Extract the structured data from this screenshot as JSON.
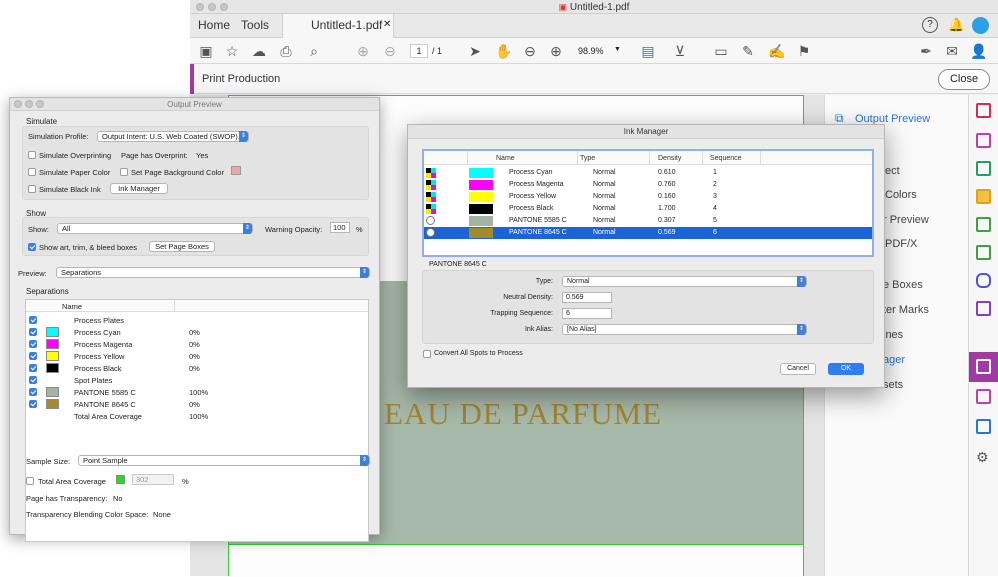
{
  "app": {
    "window_title": "Untitled-1.pdf",
    "tabs": {
      "home": "Home",
      "tools": "Tools",
      "document": "Untitled-1.pdf"
    },
    "toolbar": {
      "page_current": "1",
      "page_total": "/ 1",
      "zoom": "98.9%"
    },
    "print_production": {
      "title": "Print Production",
      "close_label": "Close"
    },
    "document_text": "EAU DE PARFUME",
    "right_panel": [
      {
        "label": "Output Preview"
      },
      {
        "label": "ect"
      },
      {
        "label": "Colors"
      },
      {
        "label": "r Preview"
      },
      {
        "label": "PDF/X"
      },
      {
        "label": "e Boxes"
      },
      {
        "label": "ter Marks"
      },
      {
        "label": "ines"
      },
      {
        "label": "ager"
      },
      {
        "label": "sets"
      }
    ]
  },
  "output_preview": {
    "title": "Output Preview",
    "simulate": {
      "header": "Simulate",
      "profile_label": "Simulation Profile:",
      "profile_value": "Output Intent: U.S. Web Coated (SWOP)...",
      "overprinting_label": "Simulate Overprinting",
      "page_overprint_label": "Page has Overprint:",
      "page_overprint_value": "Yes",
      "paper_color_label": "Simulate Paper Color",
      "bg_color_label": "Set Page Background Color",
      "black_ink_label": "Simulate Black Ink",
      "ink_manager_button": "Ink Manager"
    },
    "show": {
      "header": "Show",
      "show_label": "Show:",
      "show_value": "All",
      "warning_label": "Warning Opacity:",
      "warning_value": "100",
      "warning_unit": "%",
      "boxes_label": "Show art, trim, & bleed boxes",
      "boxes_button": "Set Page Boxes"
    },
    "preview_label": "Preview:",
    "preview_value": "Separations",
    "separations": {
      "header": "Separations",
      "column_name": "Name",
      "rows": [
        {
          "name": "Process Plates",
          "value": "",
          "color": ""
        },
        {
          "name": "Process Cyan",
          "value": "0%",
          "color": "#00ffff"
        },
        {
          "name": "Process Magenta",
          "value": "0%",
          "color": "#ff00ff"
        },
        {
          "name": "Process Yellow",
          "value": "0%",
          "color": "#ffff00"
        },
        {
          "name": "Process Black",
          "value": "0%",
          "color": "#000000"
        },
        {
          "name": "Spot Plates",
          "value": "",
          "color": ""
        },
        {
          "name": "PANTONE 5585 C",
          "value": "100%",
          "color": "#a3b3a4"
        },
        {
          "name": "PANTONE 8645 C",
          "value": "0%",
          "color": "#a08b2d"
        },
        {
          "name": "Total Area Coverage",
          "value": "100%",
          "color": ""
        }
      ]
    },
    "sample_size_label": "Sample Size:",
    "sample_size_value": "Point Sample",
    "total_area_label": "Total Area Coverage",
    "total_area_value": "302",
    "total_area_unit": "%",
    "transparency_label": "Page has Transparency:",
    "transparency_value": "No",
    "blend_label": "Transparency Blending Color Space:",
    "blend_value": "None"
  },
  "ink_manager": {
    "title": "Ink Manager",
    "columns": {
      "name": "Name",
      "type": "Type",
      "density": "Density",
      "sequence": "Sequence"
    },
    "rows": [
      {
        "name": "Process Cyan",
        "type": "Normal",
        "density": "0.610",
        "sequence": "1",
        "color": "#00ffff",
        "kind": "process"
      },
      {
        "name": "Process Magenta",
        "type": "Normal",
        "density": "0.760",
        "sequence": "2",
        "color": "#ff00ff",
        "kind": "process"
      },
      {
        "name": "Process Yellow",
        "type": "Normal",
        "density": "0.160",
        "sequence": "3",
        "color": "#ffff00",
        "kind": "process"
      },
      {
        "name": "Process Black",
        "type": "Normal",
        "density": "1.700",
        "sequence": "4",
        "color": "#000000",
        "kind": "process"
      },
      {
        "name": "PANTONE 5585 C",
        "type": "Normal",
        "density": "0.307",
        "sequence": "5",
        "color": "#a3b3a4",
        "kind": "spot"
      },
      {
        "name": "PANTONE 8645 C",
        "type": "Normal",
        "density": "0.569",
        "sequence": "6",
        "color": "#a08b2d",
        "kind": "spot"
      }
    ],
    "selected_ink": "PANTONE 8645 C",
    "type_label": "Type:",
    "type_value": "Normal",
    "density_label": "Neutral Density:",
    "density_value": "0.569",
    "trapping_label": "Trapping Sequence:",
    "trapping_value": "6",
    "alias_label": "Ink Alias:",
    "alias_value": "[No Alias]",
    "convert_label": "Convert All Spots to Process",
    "cancel_label": "Cancel",
    "ok_label": "OK"
  }
}
